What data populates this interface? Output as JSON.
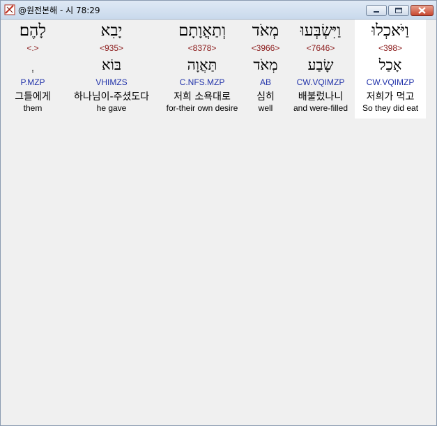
{
  "window": {
    "title": "@원전본해 - 시 78:29",
    "colors": {
      "strong": "#8b1a1a",
      "morph": "#2233aa",
      "selected_bg": "#ffffff"
    }
  },
  "controls": {
    "minimize_icon": "minimize-icon",
    "maximize_icon": "maximize-icon",
    "close_icon": "close-icon"
  },
  "words": [
    {
      "hebrew": "לָהֶם׃",
      "strong": "<.>",
      "lemma": "ְ",
      "morph": "P.MZP",
      "korean": "그들에게",
      "english": "them",
      "selected": false
    },
    {
      "hebrew": "יָבִא",
      "strong": "<935>",
      "lemma": "בּוֹא",
      "morph": "VHIMZS",
      "korean": "하나님이-주셨도다",
      "english": "he gave",
      "selected": false
    },
    {
      "hebrew": "וְתַאֲוָתָם",
      "strong": "<8378>",
      "lemma": "תַּאֲוָה",
      "morph": "C.NFS.MZP",
      "korean": "저희 소욕대로",
      "english": "for-their own desire",
      "selected": false
    },
    {
      "hebrew": "מְאֹד",
      "strong": "<3966>",
      "lemma": "מְאֹד",
      "morph": "AB",
      "korean": "심히",
      "english": "well",
      "selected": false
    },
    {
      "hebrew": "וַיִּשְׂבְּעוּ",
      "strong": "<7646>",
      "lemma": "שָׂבַע",
      "morph": "CW.VQIMZP",
      "korean": "배불렀나니",
      "english": "and were-filled",
      "selected": false
    },
    {
      "hebrew": "וַיֹּאכְלוּ",
      "strong": "<398>",
      "lemma": "אָכַל",
      "morph": "CW.VQIMZP",
      "korean": "저희가 먹고",
      "english": "So they did eat",
      "selected": true
    }
  ]
}
